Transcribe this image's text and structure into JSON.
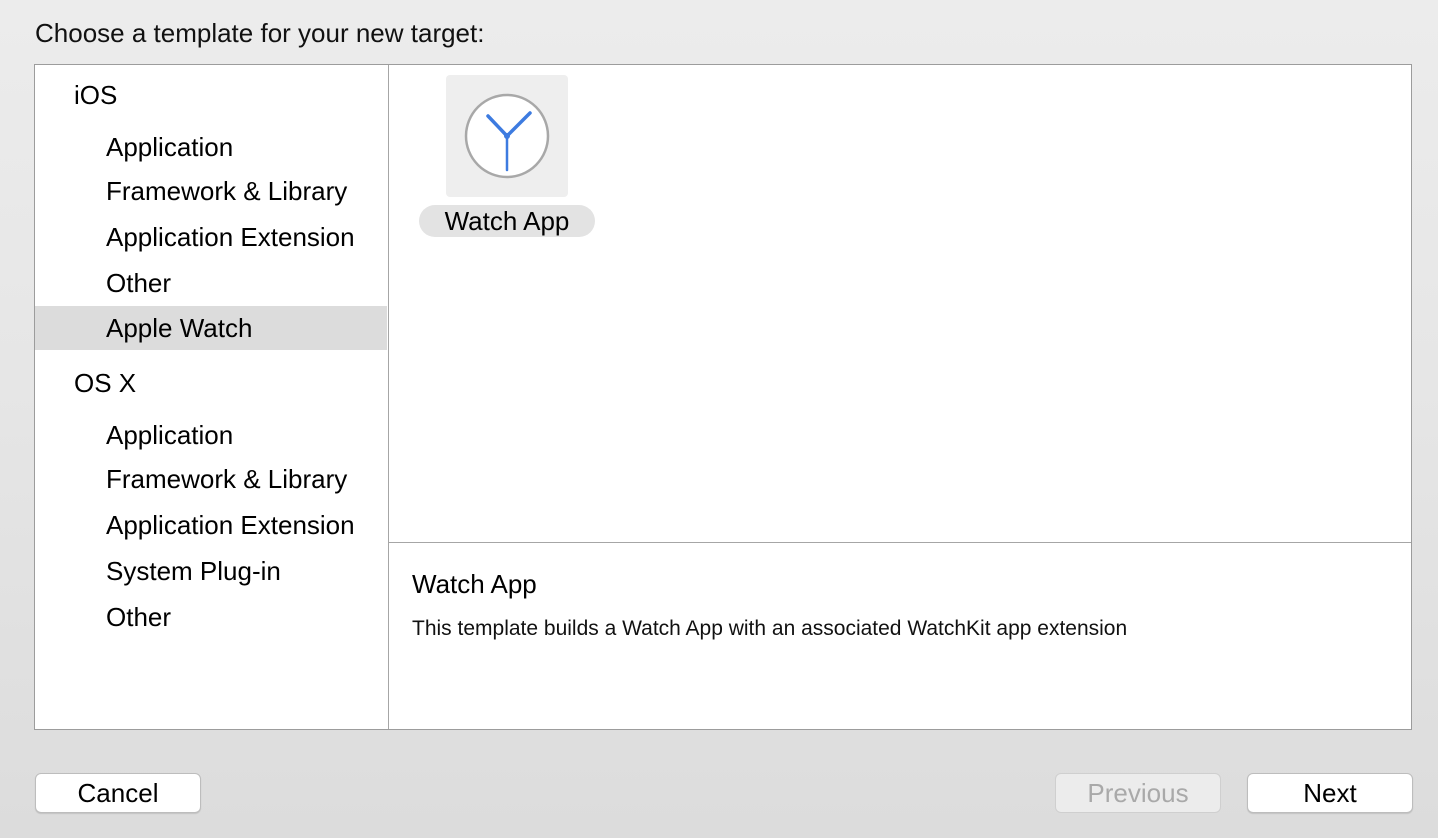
{
  "dialog": {
    "prompt": "Choose a template for your new target:"
  },
  "sidebar": {
    "sections": [
      {
        "header": "iOS",
        "items": [
          {
            "label": "Application"
          },
          {
            "label": "Framework & Library"
          },
          {
            "label": "Application Extension"
          },
          {
            "label": "Other"
          },
          {
            "label": "Apple Watch",
            "selected": true
          }
        ]
      },
      {
        "header": "OS X",
        "items": [
          {
            "label": "Application"
          },
          {
            "label": "Framework & Library"
          },
          {
            "label": "Application Extension"
          },
          {
            "label": "System Plug-in"
          },
          {
            "label": "Other"
          }
        ]
      }
    ]
  },
  "templates": [
    {
      "label": "Watch App",
      "icon": "watch-clock-icon",
      "selected": true
    }
  ],
  "description": {
    "title": "Watch App",
    "text": "This template builds a Watch App with an associated WatchKit app extension"
  },
  "buttons": {
    "cancel": "Cancel",
    "previous": "Previous",
    "previous_enabled": false,
    "next": "Next"
  },
  "colors": {
    "selection": "#dcdcdc",
    "clock_hands": "#3d7be0",
    "clock_ring": "#a8a8a8"
  }
}
